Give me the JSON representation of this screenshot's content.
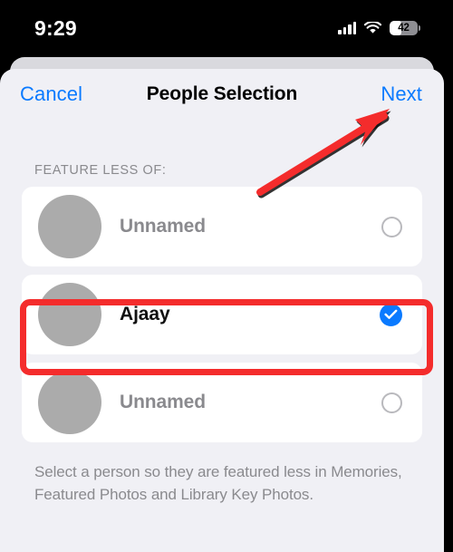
{
  "status_bar": {
    "time": "9:29",
    "cellular_icon": "cellular-signal-icon",
    "wifi_icon": "wifi-icon",
    "battery_percent": "42",
    "battery_level": 42
  },
  "modal": {
    "nav": {
      "cancel_label": "Cancel",
      "title": "People Selection",
      "next_label": "Next"
    },
    "section_header": "FEATURE LESS OF:",
    "people": [
      {
        "name": "Unnamed",
        "selected": false,
        "avatar": "person-avatar-placeholder"
      },
      {
        "name": "Ajaay",
        "selected": true,
        "avatar": "person-avatar-placeholder"
      },
      {
        "name": "Unnamed",
        "selected": false,
        "avatar": "person-avatar-placeholder"
      }
    ],
    "footer_note": "Select a person so they are featured less in Memories, Featured Photos and Library Key Photos."
  },
  "annotations": {
    "highlight_color": "#f42c2c",
    "arrow_color": "#f42c2c",
    "arrow_target": "next-button"
  },
  "colors": {
    "accent_blue": "#0a7aff",
    "sheet_bg": "#f0f0f5",
    "card_bg": "#ffffff",
    "avatar_gray": "#ababab",
    "muted_text": "#8a8a8e"
  }
}
